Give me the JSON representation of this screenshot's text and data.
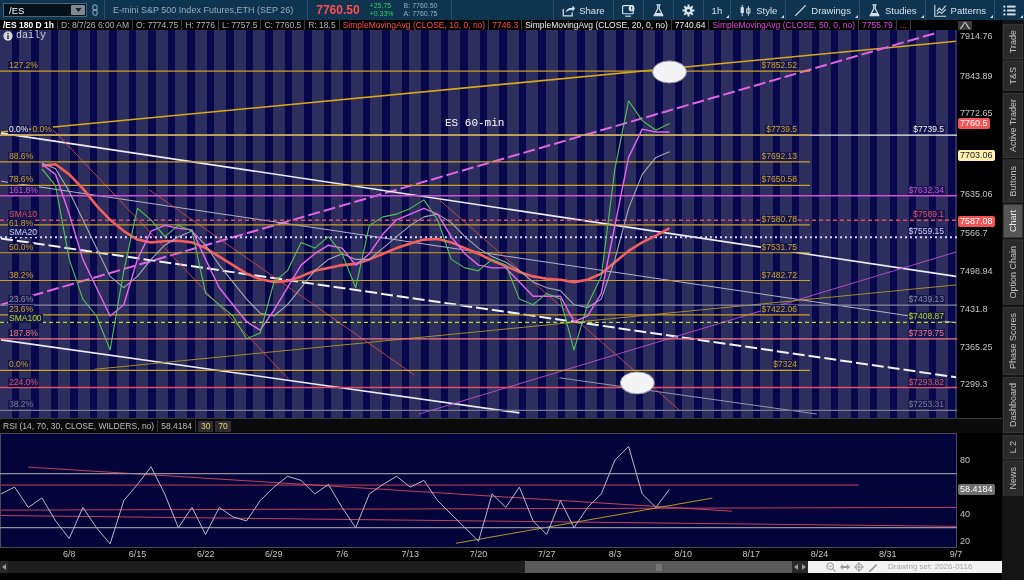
{
  "toolbar": {
    "symbol": "/ES",
    "description": "E-mini S&P 500 Index Futures,ETH (SEP 26)",
    "last": "7760.50",
    "change": "+25.75",
    "change_pct": "+0.33%",
    "bid": "B: 7760.50",
    "ask": "A: 7760.75",
    "buttons": [
      {
        "kind": "share",
        "label": "Share",
        "dropdown": false
      },
      {
        "kind": "alert",
        "dropdown": false
      },
      {
        "kind": "flask",
        "dropdown": false
      },
      {
        "kind": "settings",
        "dropdown": false
      },
      {
        "kind": "interval",
        "label": "1h",
        "dropdown": true
      },
      {
        "kind": "style",
        "label": "Style",
        "dropdown": true
      },
      {
        "kind": "drawings",
        "label": "Drawings",
        "dropdown": true
      },
      {
        "kind": "studies",
        "label": "Studies",
        "dropdown": true
      },
      {
        "kind": "patterns",
        "label": "Patterns",
        "dropdown": true
      },
      {
        "kind": "menu",
        "dropdown": true
      }
    ]
  },
  "info_bar": {
    "items": [
      {
        "kind": "symbol",
        "text": "/ES 180 D 1h"
      },
      {
        "kind": "field",
        "text": "D: 8/7/26 6:00 AM"
      },
      {
        "kind": "field",
        "text": "O: 7774.75"
      },
      {
        "kind": "field",
        "text": "H: 7776"
      },
      {
        "kind": "field",
        "text": "L: 7757.5"
      },
      {
        "kind": "field",
        "text": "C: 7760.5"
      },
      {
        "kind": "field",
        "text": "R: 18.5"
      },
      {
        "kind": "study",
        "text": "SimpleMovingAvg (CLOSE, 10, 0, no)"
      },
      {
        "kind": "value",
        "text": "7746.3"
      },
      {
        "kind": "study",
        "text": "SimpleMovingAvg (CLOSE, 20, 0, no)"
      },
      {
        "kind": "value",
        "text": "7740.64"
      },
      {
        "kind": "study",
        "text": "SimpleMovingAvg (CLOSE, 50, 0, no)"
      },
      {
        "kind": "value",
        "text": "7755.79"
      },
      {
        "kind": "more",
        "text": "..."
      }
    ]
  },
  "main_chart": {
    "corner_label": "daily",
    "chart_data": {
      "type": "line",
      "title": "ES 60-min",
      "categories": [
        null,
        null,
        null,
        null,
        null,
        null,
        null,
        null,
        null,
        null,
        null,
        null,
        null,
        null,
        null,
        null,
        null,
        null,
        null,
        null,
        null,
        null,
        null,
        null,
        null,
        null,
        null,
        null,
        null,
        null,
        null,
        null,
        null,
        null,
        null,
        null,
        null,
        null,
        null,
        null,
        null,
        null,
        null,
        null,
        null,
        null,
        null,
        null,
        null,
        null,
        null,
        null,
        null,
        null,
        null,
        null,
        null,
        null,
        null,
        null,
        null,
        null,
        null,
        null,
        null,
        null,
        null,
        null,
        null,
        null,
        null
      ],
      "ylim": [
        7240,
        7925
      ],
      "yticks": [
        7914.76,
        7843.89,
        7772.65,
        7635.06,
        7566.7,
        7498.94,
        7431.8,
        7365.25,
        7299.3
      ],
      "series": [
        {
          "color": "#f25f5c",
          "values": [
            null,
            null,
            null,
            7685,
            7688,
            7670,
            7645,
            7615,
            7590,
            7570,
            7555,
            7550,
            7552,
            7553,
            7550,
            7540,
            7525,
            7510,
            7495,
            7485,
            7480,
            7482,
            7490,
            7500,
            7505,
            7510,
            7512,
            7520,
            7530,
            7540,
            7548,
            7555,
            7556,
            7550,
            7540,
            7530,
            7518,
            7508,
            7498,
            7490,
            7486,
            7484,
            7480,
            7484,
            7495,
            7515,
            7535,
            7550,
            7562,
            7575,
            null,
            null,
            null,
            null,
            null,
            null,
            null,
            null,
            null,
            null,
            null,
            null,
            null,
            null,
            null,
            null,
            null,
            null,
            null,
            null,
            null
          ]
        },
        {
          "color": "#a8a8b4",
          "values": [
            null,
            null,
            null,
            7690,
            7680,
            7640,
            7590,
            7540,
            7490,
            7470,
            7490,
            7520,
            7545,
            7560,
            7570,
            7545,
            7510,
            7480,
            7450,
            7425,
            7420,
            7440,
            7470,
            7500,
            7520,
            7530,
            7520,
            7520,
            7540,
            7560,
            7580,
            7595,
            7600,
            7585,
            7560,
            7540,
            7525,
            7515,
            7500,
            7480,
            7470,
            7465,
            7440,
            7435,
            7450,
            7520,
            7610,
            7670,
            7700,
            7710,
            null,
            null,
            null,
            null,
            null,
            null,
            null,
            null,
            null,
            null,
            null,
            null,
            null,
            null,
            null,
            null,
            null,
            null,
            null,
            null,
            null
          ]
        },
        {
          "color": "#e864f0",
          "values": [
            null,
            null,
            null,
            7688,
            7670,
            7600,
            7520,
            7470,
            7420,
            7440,
            7520,
            7570,
            7580,
            7575,
            7572,
            7520,
            7470,
            7440,
            7410,
            7395,
            7430,
            7470,
            7510,
            7530,
            7545,
            7540,
            7510,
            7530,
            7565,
            7590,
            7600,
            7610,
            7600,
            7560,
            7530,
            7510,
            7505,
            7505,
            7480,
            7455,
            7455,
            7455,
            7410,
            7420,
            7460,
            7580,
            7700,
            7750,
            7745,
            7745,
            null,
            null,
            null,
            null,
            null,
            null,
            null,
            null,
            null,
            null,
            null,
            null,
            null,
            null,
            null,
            null,
            null,
            null,
            null,
            null,
            null
          ]
        },
        {
          "color": "#52c452",
          "values": [
            null,
            null,
            null,
            7680,
            7650,
            7520,
            7450,
            7420,
            7360,
            7500,
            7610,
            7590,
            7560,
            7580,
            7570,
            7460,
            7440,
            7420,
            7380,
            7390,
            7480,
            7500,
            7550,
            7540,
            7560,
            7530,
            7470,
            7580,
            7595,
            7600,
            7610,
            7625,
            7590,
            7520,
            7505,
            7500,
            7520,
            7510,
            7450,
            7440,
            7460,
            7450,
            7360,
            7440,
            7490,
            7680,
            7800,
            7765,
            7748,
            7760,
            null,
            null,
            null,
            null,
            null,
            null,
            null,
            null,
            null,
            null,
            null,
            null,
            null,
            null,
            null,
            null,
            null,
            null,
            null,
            null,
            null
          ]
        }
      ],
      "ref_lines": [
        {
          "axis": "y",
          "value": 7852.52,
          "label": "$7852.52",
          "color": "#c9a227"
        },
        {
          "axis": "y",
          "value": 7739.5,
          "label": "$7739.5",
          "color": "#f2f2f2"
        },
        {
          "axis": "y",
          "value": 7739.5,
          "label": "$7739.5",
          "color": "#c9a227"
        },
        {
          "axis": "y",
          "value": 7692.13,
          "label": "$7692.13",
          "color": "#c9a227"
        },
        {
          "axis": "y",
          "value": 7650.58,
          "label": "$7650.58",
          "color": "#c9a227"
        },
        {
          "axis": "y",
          "value": 7632.34,
          "label": "$7632.34",
          "color": "#d24fd6"
        },
        {
          "axis": "y",
          "value": 7589.1,
          "label": "$7589.1",
          "color": "#e0505a"
        },
        {
          "axis": "y",
          "value": 7580.78,
          "label": "$7580.78",
          "color": "#c9a227"
        },
        {
          "axis": "y",
          "value": 7559.15,
          "label": "$7559.15",
          "color": "#d8d0ff"
        },
        {
          "axis": "y",
          "value": 7531.75,
          "label": "$7531.75",
          "color": "#c9a227"
        },
        {
          "axis": "y",
          "value": 7482.72,
          "label": "$7482.72",
          "color": "#c9a227"
        },
        {
          "axis": "y",
          "value": 7439.13,
          "label": "$7439.13",
          "color": "#8a8a9c"
        },
        {
          "axis": "y",
          "value": 7422.06,
          "label": "$7422.06",
          "color": "#c9a227"
        },
        {
          "axis": "y",
          "value": 7408.87,
          "label": "$7408.87",
          "color": "#b4dc1e"
        },
        {
          "axis": "y",
          "value": 7379.75,
          "label": "$7379.75",
          "color": "#f07a86"
        },
        {
          "axis": "y",
          "value": 7324,
          "label": "$7324",
          "color": "#c9a227"
        },
        {
          "axis": "y",
          "value": 7293.82,
          "label": "$7293.82",
          "color": "#e0506a"
        },
        {
          "axis": "y",
          "value": 7253.31,
          "label": "$7253.31",
          "color": "#7c7c8e"
        }
      ],
      "annotations": [
        "127.2%",
        "0.0%",
        "0.0%",
        "88.6%",
        "78.6%",
        "161.8%",
        "SMA10",
        "61.8%",
        "SMA20",
        "50.0%",
        "38.2%",
        "23.6%",
        "23.6%",
        "SMA100",
        "187.8%",
        "0.0%",
        "224.0%",
        "38.2%",
        {
          "text": "7760.5",
          "y": 7760.5
        },
        {
          "text": "7703.06",
          "y": 7703.06
        },
        {
          "text": "7587.08",
          "y": 7587.08
        }
      ]
    }
  },
  "rsi_panel": {
    "header": "RSI (14, 70, 30, CLOSE, WILDERS, no)",
    "reading": "58.4184",
    "levels": [
      "30",
      "70"
    ],
    "chart_data": {
      "type": "line",
      "categories": [
        null,
        null,
        null,
        null,
        null,
        "6/8",
        null,
        null,
        null,
        null,
        "6/15",
        null,
        null,
        null,
        null,
        "6/22",
        null,
        null,
        null,
        null,
        "6/29",
        null,
        null,
        null,
        null,
        "7/6",
        null,
        null,
        null,
        null,
        "7/13",
        null,
        null,
        null,
        null,
        "7/20",
        null,
        null,
        null,
        null,
        "7/27",
        null,
        null,
        null,
        null,
        "8/3",
        null,
        null,
        null,
        null,
        "8/10",
        null,
        null,
        null,
        null,
        "8/17",
        null,
        null,
        null,
        null,
        "8/24",
        null,
        null,
        null,
        null,
        "8/31",
        null,
        null,
        null,
        null,
        "9/7"
      ],
      "ylim": [
        15,
        100
      ],
      "yticks": [
        20,
        40,
        80
      ],
      "series": [
        {
          "color": "#b8b8c8",
          "values": [
            55,
            60,
            45,
            52,
            35,
            22,
            45,
            30,
            18,
            50,
            62,
            75,
            55,
            30,
            45,
            25,
            45,
            38,
            35,
            50,
            60,
            68,
            65,
            55,
            62,
            45,
            30,
            55,
            62,
            68,
            60,
            65,
            50,
            40,
            30,
            20,
            55,
            45,
            60,
            35,
            25,
            50,
            30,
            45,
            55,
            80,
            90,
            55,
            45,
            58.4,
            null,
            null,
            null,
            null,
            null,
            null,
            null,
            null,
            null,
            null,
            null,
            null,
            null,
            null,
            null,
            null,
            null,
            null,
            null,
            null,
            null
          ]
        }
      ],
      "ref_lines": [
        {
          "axis": "y",
          "value": 70,
          "color": "#9090a0"
        },
        {
          "axis": "y",
          "value": 30,
          "color": "#9090a0"
        }
      ],
      "annotations": [
        {
          "text": "58.4184",
          "y": 58.4184
        }
      ]
    }
  },
  "scroll_bar": {
    "drawing_set": "Drawing set: 2026-0116"
  },
  "side_tabs": [
    {
      "label": "Trade",
      "selected": false
    },
    {
      "label": "T&S",
      "selected": false
    },
    {
      "label": "Active Trader",
      "selected": false
    },
    {
      "label": "Buttons",
      "selected": false
    },
    {
      "label": "Chart",
      "selected": true
    },
    {
      "label": "Option Chain",
      "selected": false
    },
    {
      "label": "Phase Scores",
      "selected": false
    },
    {
      "label": "Dashboard",
      "selected": false
    },
    {
      "label": "L 2",
      "selected": false
    },
    {
      "label": "News",
      "selected": false
    }
  ]
}
